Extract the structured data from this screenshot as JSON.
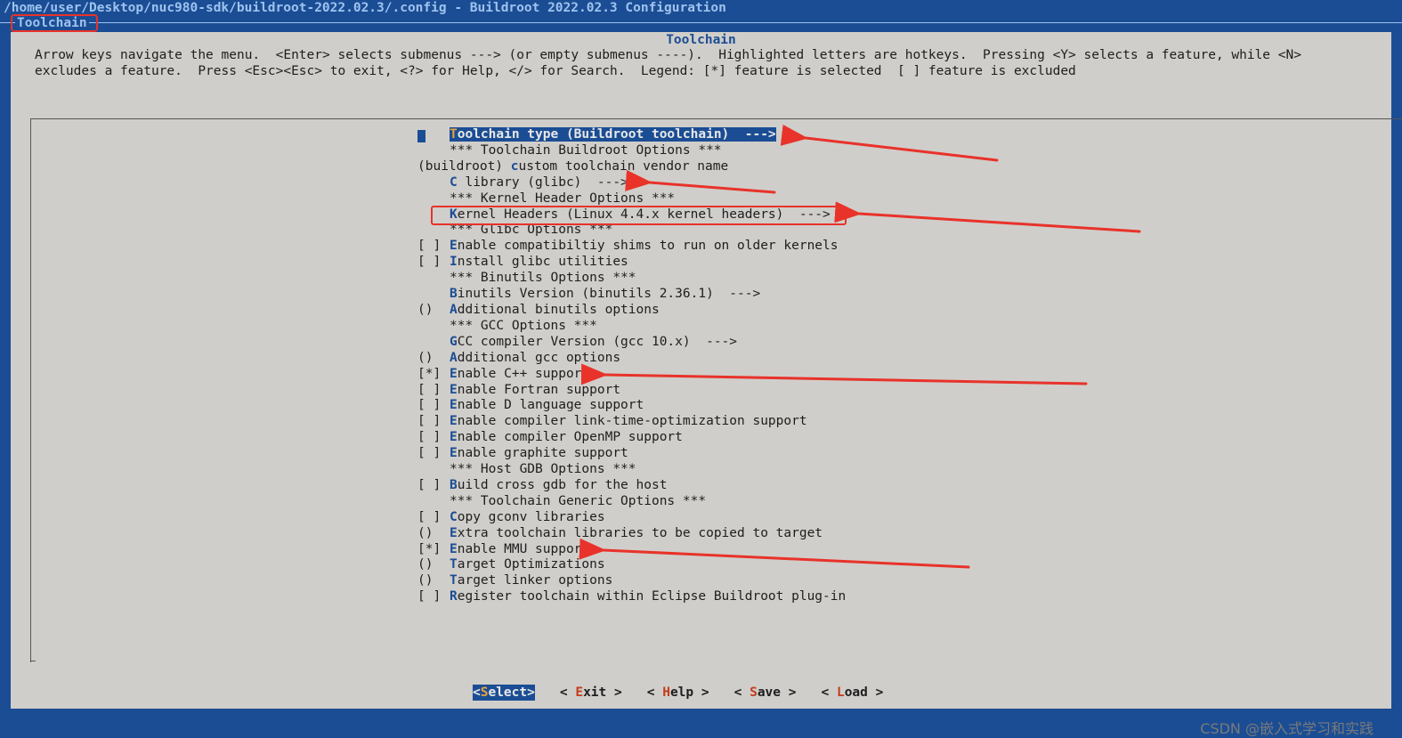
{
  "window": {
    "title": "/home/user/Desktop/nuc980-sdk/buildroot-2022.02.3/.config - Buildroot 2022.02.3 Configuration",
    "breadcrumb": "Toolchain"
  },
  "dialog": {
    "title": "Toolchain",
    "help_line1": "Arrow keys navigate the menu.  <Enter> selects submenus ---> (or empty submenus ----).  Highlighted letters are hotkeys.  Pressing <Y> selects a feature, while <N>",
    "help_line2": "excludes a feature.  Press <Esc><Esc> to exit, <?> for Help, </> for Search.  Legend: [*] feature is selected  [ ] feature is excluded"
  },
  "menu": {
    "items": [
      {
        "prefix": "",
        "hotkey": "T",
        "rest": "oolchain type (Buildroot toolchain)  --->",
        "selected": true
      },
      {
        "prefix": "",
        "hotkey": "",
        "rest": "*** Toolchain Buildroot Options ***"
      },
      {
        "prefix": "(buildroot) ",
        "hotkey": "c",
        "rest": "ustom toolchain vendor name",
        "inline": true
      },
      {
        "prefix": "",
        "hotkey": "C",
        "rest": " library (glibc)  --->"
      },
      {
        "prefix": "",
        "hotkey": "",
        "rest": "*** Kernel Header Options ***"
      },
      {
        "prefix": "",
        "hotkey": "K",
        "rest": "ernel Headers (Linux 4.4.x kernel headers)  --->"
      },
      {
        "prefix": "",
        "hotkey": "",
        "rest": "*** Glibc Options ***"
      },
      {
        "prefix": "[ ]",
        "hotkey": "E",
        "rest": "nable compatibiltiy shims to run on older kernels"
      },
      {
        "prefix": "[ ]",
        "hotkey": "I",
        "rest": "nstall glibc utilities"
      },
      {
        "prefix": "",
        "hotkey": "",
        "rest": "*** Binutils Options ***"
      },
      {
        "prefix": "",
        "hotkey": "B",
        "rest": "inutils Version (binutils 2.36.1)  --->"
      },
      {
        "prefix": "()",
        "hotkey": "A",
        "rest": "dditional binutils options"
      },
      {
        "prefix": "",
        "hotkey": "",
        "rest": "*** GCC Options ***"
      },
      {
        "prefix": "",
        "hotkey": "G",
        "rest": "CC compiler Version (gcc 10.x)  --->"
      },
      {
        "prefix": "()",
        "hotkey": "A",
        "rest": "dditional gcc options"
      },
      {
        "prefix": "[*]",
        "hotkey": "E",
        "rest": "nable C++ support"
      },
      {
        "prefix": "[ ]",
        "hotkey": "E",
        "rest": "nable Fortran support"
      },
      {
        "prefix": "[ ]",
        "hotkey": "E",
        "rest": "nable D language support"
      },
      {
        "prefix": "[ ]",
        "hotkey": "E",
        "rest": "nable compiler link-time-optimization support"
      },
      {
        "prefix": "[ ]",
        "hotkey": "E",
        "rest": "nable compiler OpenMP support"
      },
      {
        "prefix": "[ ]",
        "hotkey": "E",
        "rest": "nable graphite support"
      },
      {
        "prefix": "",
        "hotkey": "",
        "rest": "*** Host GDB Options ***"
      },
      {
        "prefix": "[ ]",
        "hotkey": "B",
        "rest": "uild cross gdb for the host"
      },
      {
        "prefix": "",
        "hotkey": "",
        "rest": "*** Toolchain Generic Options ***"
      },
      {
        "prefix": "[ ]",
        "hotkey": "C",
        "rest": "opy gconv libraries"
      },
      {
        "prefix": "()",
        "hotkey": "E",
        "rest": "xtra toolchain libraries to be copied to target"
      },
      {
        "prefix": "[*]",
        "hotkey": "E",
        "rest": "nable MMU support"
      },
      {
        "prefix": "()",
        "hotkey": "T",
        "rest": "arget Optimizations"
      },
      {
        "prefix": "()",
        "hotkey": "T",
        "rest": "arget linker options"
      },
      {
        "prefix": "[ ]",
        "hotkey": "R",
        "rest": "egister toolchain within Eclipse Buildroot plug-in"
      }
    ]
  },
  "buttons": [
    {
      "open": "<",
      "hotkey": "S",
      "rest": "elect",
      "close": ">",
      "active": true
    },
    {
      "open": "< ",
      "hotkey": "E",
      "rest": "xit",
      "close": " >"
    },
    {
      "open": "< ",
      "hotkey": "H",
      "rest": "elp",
      "close": " >"
    },
    {
      "open": "< ",
      "hotkey": "S",
      "rest": "ave",
      "close": " >"
    },
    {
      "open": "< ",
      "hotkey": "L",
      "rest": "oad",
      "close": " >"
    }
  ],
  "watermark": "CSDN @嵌入式学习和实践",
  "colors": {
    "background": "#1b4d94",
    "dialog": "#d0ceca",
    "hotkey": "#1b4d94",
    "annotation": "#e8322a"
  }
}
